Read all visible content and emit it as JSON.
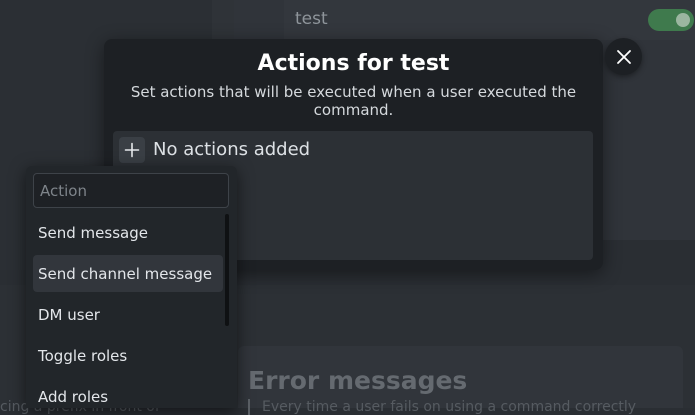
{
  "background": {
    "command_name": "test",
    "error_section_title": "Error messages",
    "error_section_desc": "Every time a user fails on using a command correctly",
    "left_desc": "cing a prefix in front of"
  },
  "modal": {
    "title": "Actions for test",
    "description": "Set actions that will be executed when a user executed the command.",
    "empty_text": "No actions added"
  },
  "dropdown": {
    "placeholder": "Action",
    "items": [
      {
        "label": "Send message"
      },
      {
        "label": "Send channel message"
      },
      {
        "label": "DM user"
      },
      {
        "label": "Toggle roles"
      },
      {
        "label": "Add roles"
      }
    ]
  },
  "colors": {
    "accent_toggle": "#3f7a4d",
    "modal_bg": "#1d2024"
  }
}
